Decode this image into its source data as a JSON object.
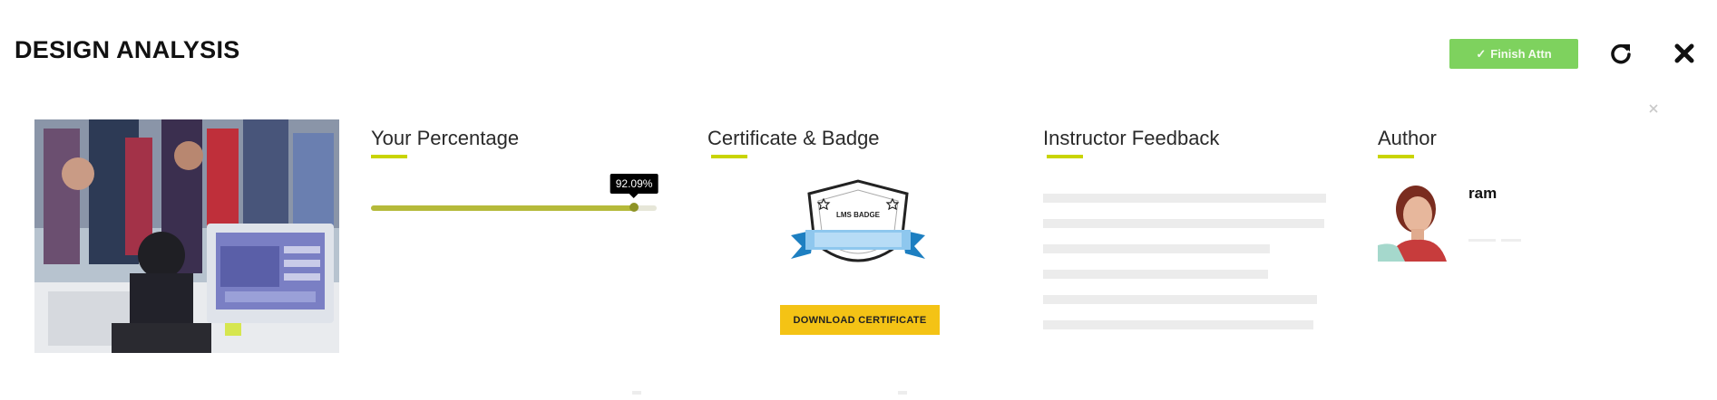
{
  "header": {
    "title": "DESIGN ANALYSIS",
    "finish_button": "Finish Attn"
  },
  "percentage": {
    "heading": "Your Percentage",
    "value": 92.09,
    "tooltip": "92.09%"
  },
  "certificate": {
    "heading": "Certificate & Badge",
    "badge_text": "LMS BADGE",
    "download_label": "DOWNLOAD CERTIFICATE"
  },
  "feedback": {
    "heading": "Instructor Feedback"
  },
  "author": {
    "heading": "Author",
    "name": "ram"
  },
  "colors": {
    "accent_underline": "#c9d400",
    "finish_button": "#7ed25e",
    "download_button": "#f4c315",
    "progress_fill": "#b5ba3a"
  },
  "icons": [
    "refresh-icon",
    "close-icon",
    "small-close-icon",
    "check-icon"
  ]
}
